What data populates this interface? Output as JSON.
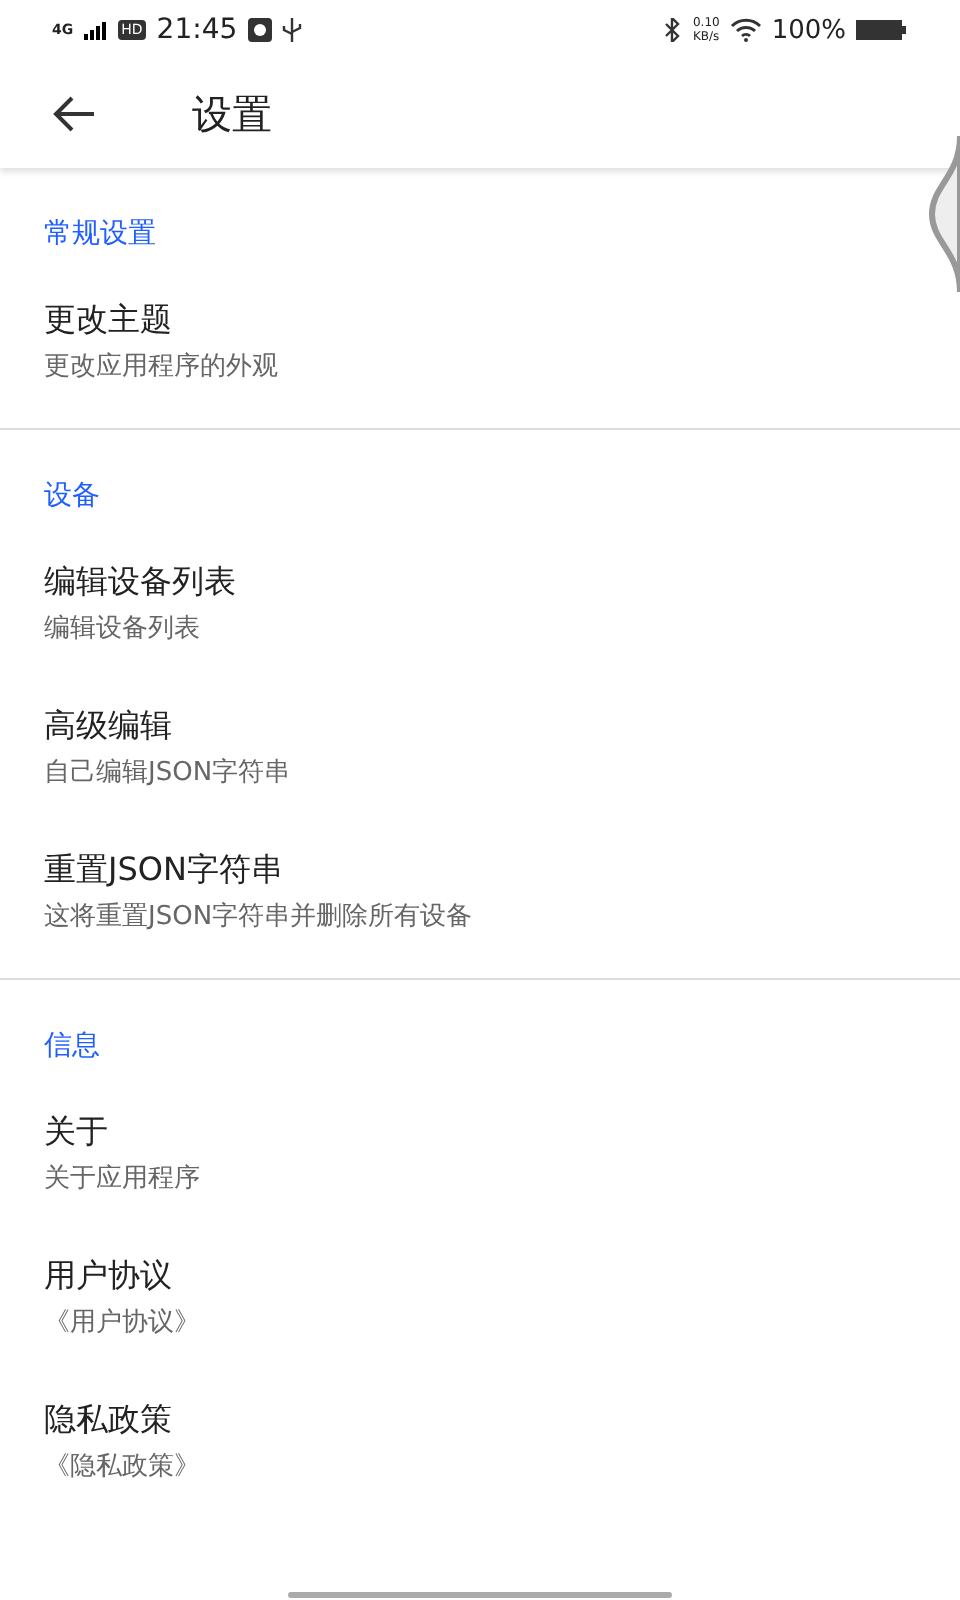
{
  "status_bar": {
    "network": "4G",
    "hd": "HD",
    "time": "21:45",
    "speed": "0.10",
    "speed_unit": "KB/s",
    "battery": "100%"
  },
  "app_bar": {
    "title": "设置"
  },
  "sections": [
    {
      "title": "常规设置",
      "items": [
        {
          "title": "更改主题",
          "subtitle": "更改应用程序的外观"
        }
      ]
    },
    {
      "title": "设备",
      "items": [
        {
          "title": "编辑设备列表",
          "subtitle": "编辑设备列表"
        },
        {
          "title": "高级编辑",
          "subtitle": "自己编辑JSON字符串"
        },
        {
          "title": "重置JSON字符串",
          "subtitle": "这将重置JSON字符串并删除所有设备"
        }
      ]
    },
    {
      "title": "信息",
      "items": [
        {
          "title": "关于",
          "subtitle": "关于应用程序"
        },
        {
          "title": "用户协议",
          "subtitle": "《用户协议》"
        },
        {
          "title": "隐私政策",
          "subtitle": "《隐私政策》"
        }
      ]
    }
  ]
}
